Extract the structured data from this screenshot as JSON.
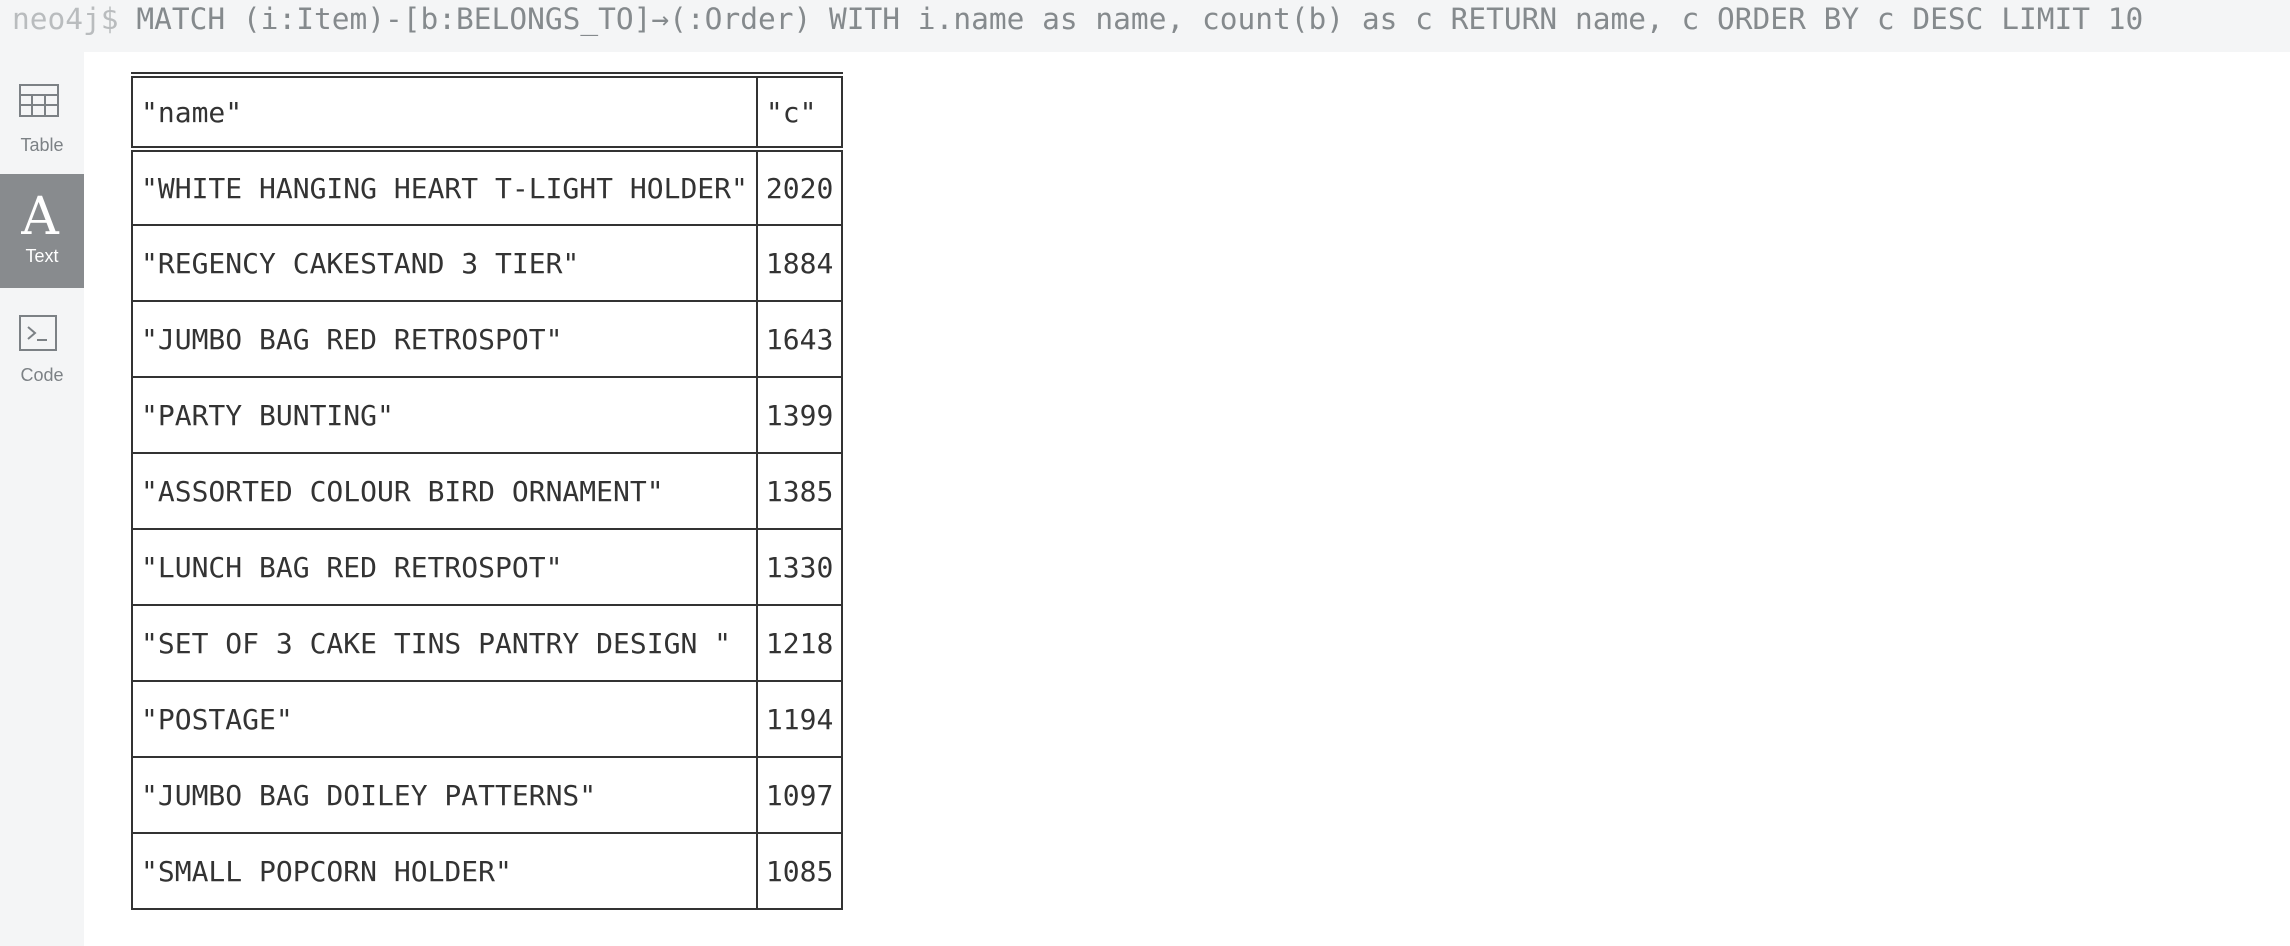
{
  "query_bar": {
    "prompt": "neo4j$",
    "query": "MATCH (i:Item)-[b:BELONGS_TO]→(:Order) WITH i.name as name, count(b) as c RETURN name, c ORDER BY c DESC LIMIT 10"
  },
  "sidebar": {
    "items": [
      {
        "label": "Table",
        "icon": "table-icon",
        "active": false
      },
      {
        "label": "Text",
        "icon": "text-icon",
        "active": true
      },
      {
        "label": "Code",
        "icon": "code-icon",
        "active": false
      }
    ]
  },
  "result": {
    "columns": [
      "\"name\"",
      "\"c\""
    ],
    "rows": [
      [
        "\"WHITE HANGING HEART T-LIGHT HOLDER\"",
        "2020"
      ],
      [
        "\"REGENCY CAKESTAND 3 TIER\"",
        "1884"
      ],
      [
        "\"JUMBO BAG RED RETROSPOT\"",
        "1643"
      ],
      [
        "\"PARTY BUNTING\"",
        "1399"
      ],
      [
        "\"ASSORTED COLOUR BIRD ORNAMENT\"",
        "1385"
      ],
      [
        "\"LUNCH BAG RED RETROSPOT\"",
        "1330"
      ],
      [
        "\"SET OF 3 CAKE TINS PANTRY DESIGN \"",
        "1218"
      ],
      [
        "\"POSTAGE\"",
        "1194"
      ],
      [
        "\"JUMBO BAG DOILEY PATTERNS\"",
        "1097"
      ],
      [
        "\"SMALL POPCORN HOLDER\"",
        "1085"
      ]
    ]
  }
}
